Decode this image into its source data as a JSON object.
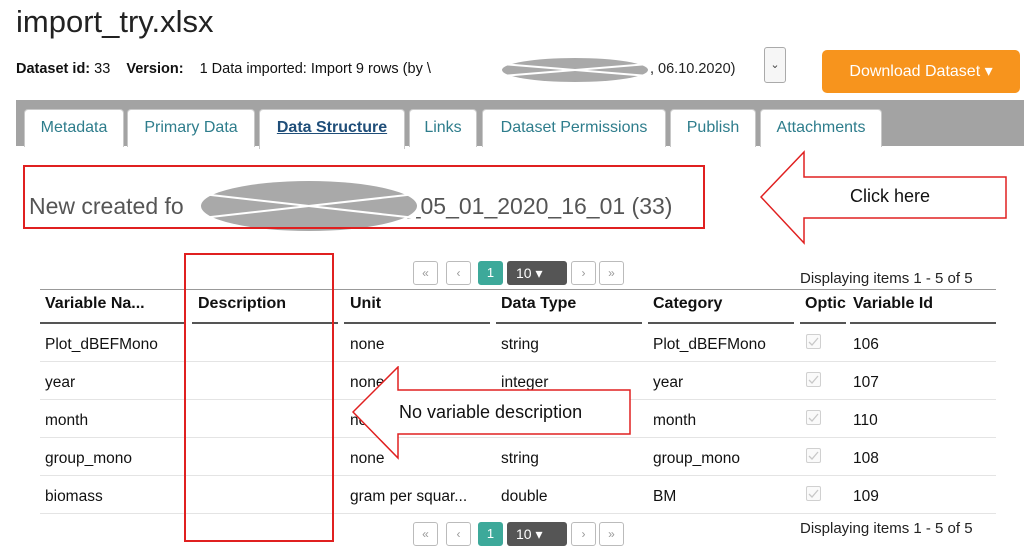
{
  "title": "import_try.xlsx",
  "meta": {
    "dataset_id_label": "Dataset id:",
    "dataset_id": "33",
    "version_label": "Version:",
    "version_text": "1 Data imported: Import 9 rows (by \\",
    "version_date": ", 06.10.2020)"
  },
  "download_label": "Download Dataset ▾",
  "tabs": [
    {
      "label": "Metadata"
    },
    {
      "label": "Primary Data"
    },
    {
      "label": "Data Structure"
    },
    {
      "label": "Links"
    },
    {
      "label": "Dataset Permissions"
    },
    {
      "label": "Publish"
    },
    {
      "label": "Attachments"
    }
  ],
  "dataset_heading_left": "New created fo",
  "dataset_heading_right": "_05_01_2020_16_01 (33)",
  "callouts": {
    "click_here": "Click here",
    "no_description": "No variable description"
  },
  "pager": {
    "first": "«",
    "prev": "‹",
    "current": "1",
    "page_size": "10 ▾",
    "next": "›",
    "last": "»",
    "info": "Displaying items 1 - 5 of 5"
  },
  "columns": [
    "Variable Na...",
    "Description",
    "Unit",
    "Data Type",
    "Category",
    "Optic",
    "Variable Id"
  ],
  "rows": [
    {
      "name": "Plot_dBEFMono",
      "description": "",
      "unit": "none",
      "type": "string",
      "category": "Plot_dBEFMono",
      "id": "106"
    },
    {
      "name": "year",
      "description": "",
      "unit": "none",
      "type": "integer",
      "category": "year",
      "id": "107"
    },
    {
      "name": "month",
      "description": "",
      "unit": "no",
      "type": "",
      "category": "month",
      "id": "110"
    },
    {
      "name": "group_mono",
      "description": "",
      "unit": "none",
      "type": "string",
      "category": "group_mono",
      "id": "108"
    },
    {
      "name": "biomass",
      "description": "",
      "unit": "gram per squar...",
      "type": "double",
      "category": "BM",
      "id": "109"
    }
  ],
  "colors": {
    "accent_orange": "#f7941d",
    "tab_bar": "#a3a3a3",
    "pager_current": "#3da99a",
    "annotation_red": "#e02020"
  }
}
